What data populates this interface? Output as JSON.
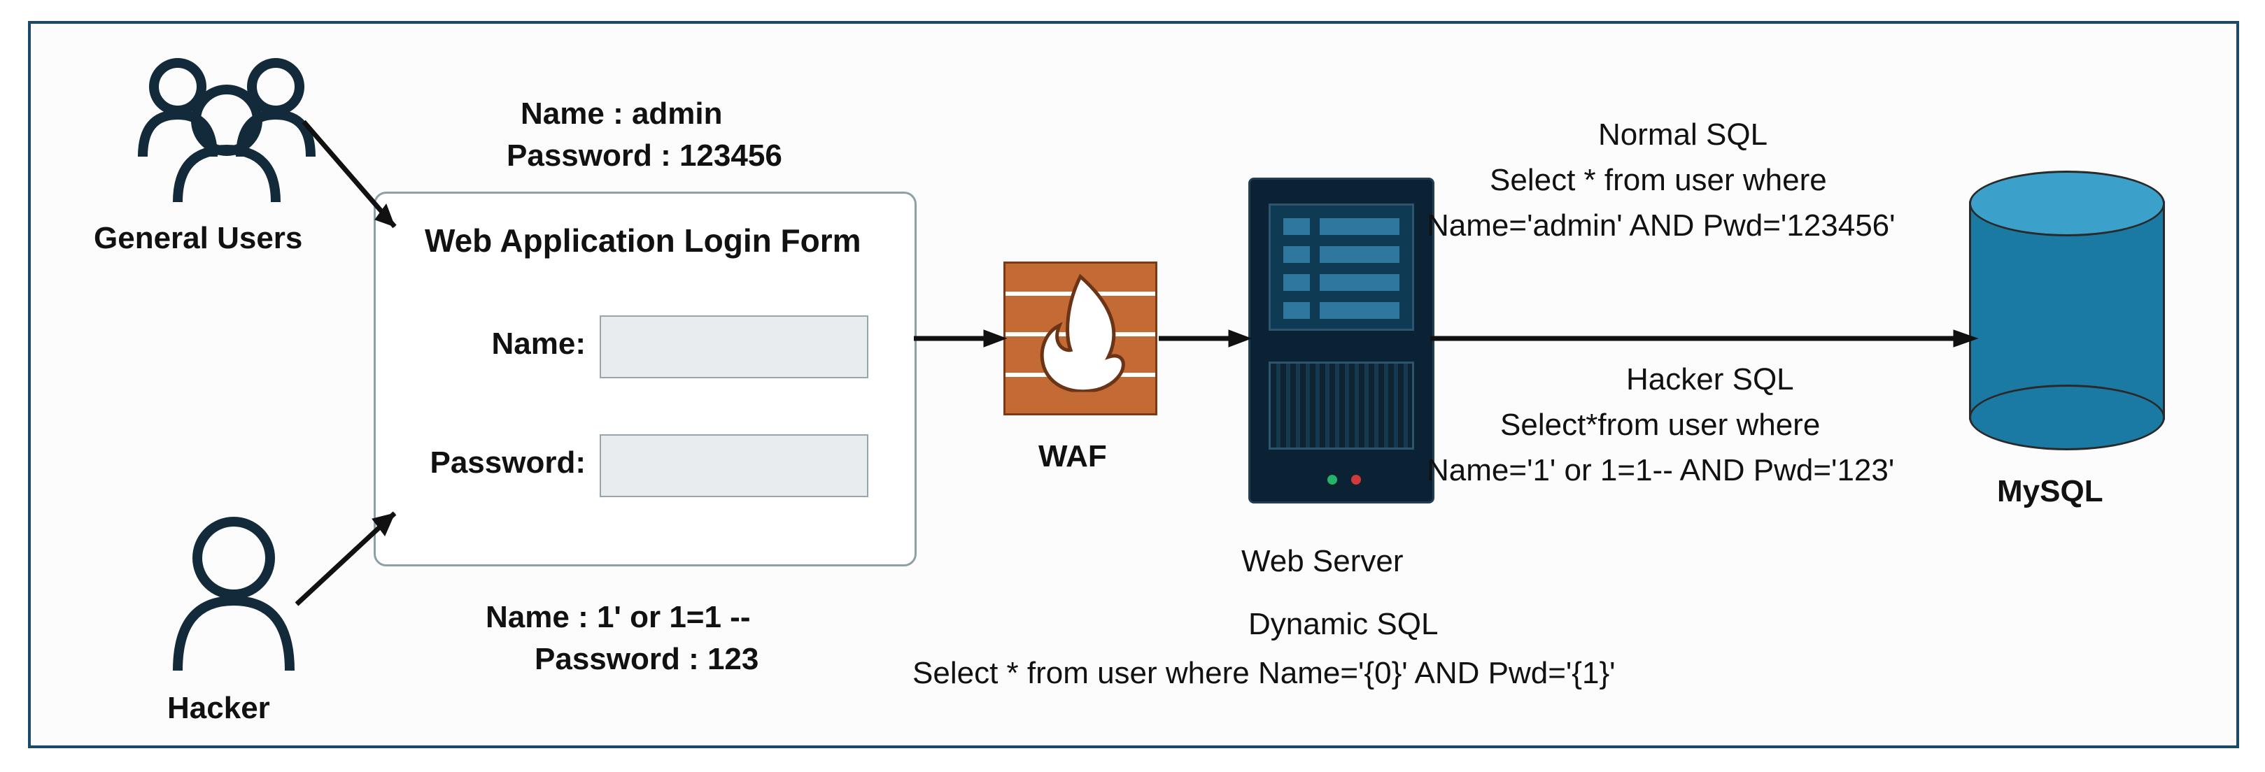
{
  "actors": {
    "general_users": "General Users",
    "hacker": "Hacker"
  },
  "credentials": {
    "normal_name": "Name : admin",
    "normal_pwd": "Password : 123456",
    "hacker_name": "Name : 1' or 1=1 --",
    "hacker_pwd": "Password : 123"
  },
  "login_form": {
    "title": "Web Application Login Form",
    "name_label": "Name:",
    "pwd_label": "Password:"
  },
  "waf_label": "WAF",
  "server": {
    "label": "Web Server",
    "dyn_label": "Dynamic SQL",
    "dyn_sql": "Select * from user where Name='{0}' AND Pwd='{1}'"
  },
  "sql": {
    "normal_title": "Normal SQL",
    "normal_line1": "Select * from user where",
    "normal_line2": "Name='admin' AND Pwd='123456'",
    "hacker_title": "Hacker SQL",
    "hacker_line1": "Select*from user where",
    "hacker_line2": "Name='1' or 1=1-- AND Pwd='123'"
  },
  "db_label": "MySQL"
}
